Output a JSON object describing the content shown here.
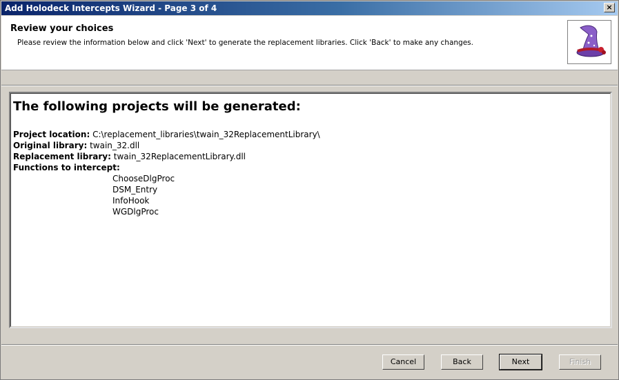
{
  "window": {
    "title": "Add Holodeck Intercepts Wizard - Page 3 of 4",
    "close_label": "×"
  },
  "header": {
    "title": "Review your choices",
    "subtitle": "Please review the information below and click 'Next' to generate the replacement libraries. Click 'Back' to make any changes."
  },
  "content": {
    "heading": "The following projects will be generated:",
    "project_location_label": "Project location:",
    "project_location_value": "C:\\replacement_libraries\\twain_32ReplacementLibrary\\",
    "original_library_label": "Original library:",
    "original_library_value": "twain_32.dll",
    "replacement_library_label": "Replacement library:",
    "replacement_library_value": "twain_32ReplacementLibrary.dll",
    "functions_label": "Functions to intercept:",
    "functions": [
      "ChooseDlgProc",
      "DSM_Entry",
      "InfoHook",
      "WGDlgProc"
    ]
  },
  "buttons": {
    "cancel": "Cancel",
    "back": "Back",
    "next": "Next",
    "finish": "Finish"
  }
}
